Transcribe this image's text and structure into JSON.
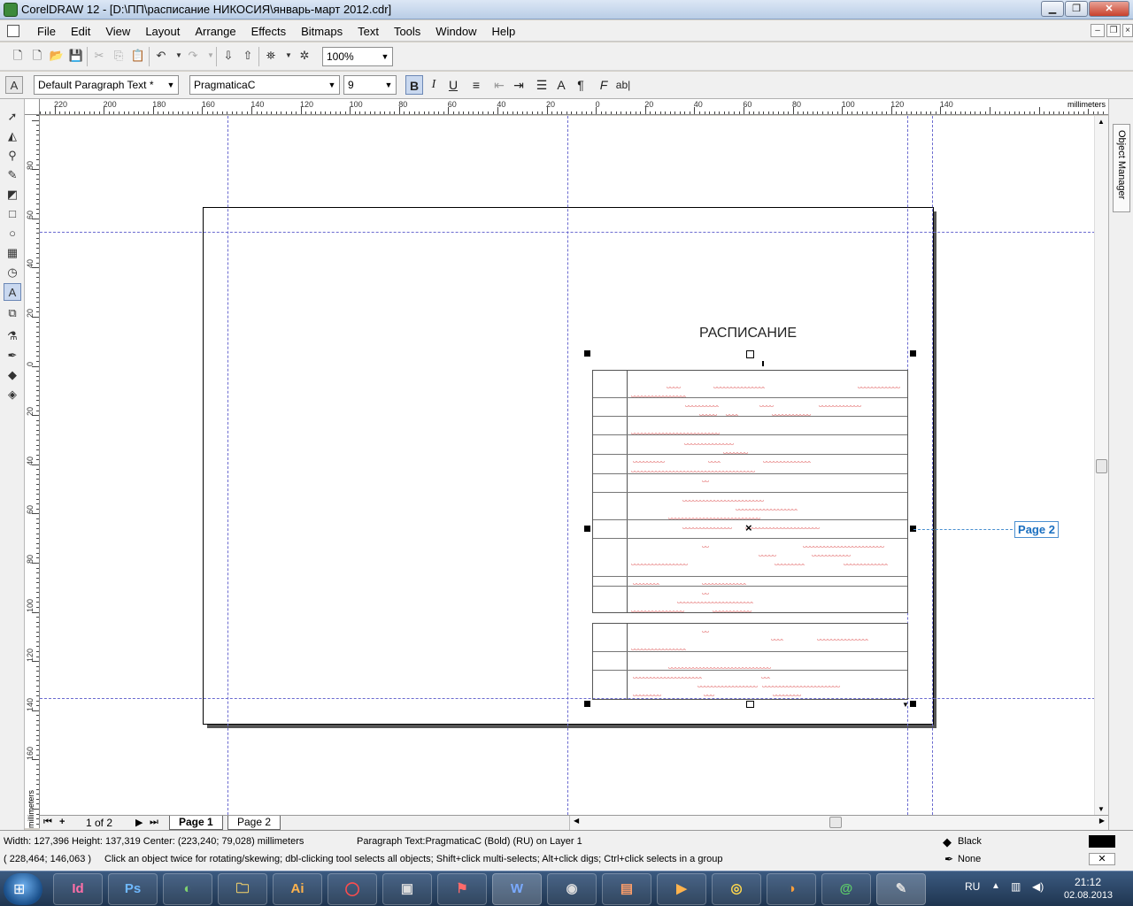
{
  "window": {
    "title": "CorelDRAW 12 - [D:\\ПП\\расписание НИКОСИЯ\\январь-март 2012.cdr]"
  },
  "menu": [
    "File",
    "Edit",
    "View",
    "Layout",
    "Arrange",
    "Effects",
    "Bitmaps",
    "Text",
    "Tools",
    "Window",
    "Help"
  ],
  "toolbar": {
    "zoom": "100%",
    "paragraph_style": "Default Paragraph Text *",
    "font": "PragmaticaC",
    "font_size": "9",
    "format_buttons": {
      "bold": "B",
      "italic": "I",
      "underline": "U",
      "frame": "ab|"
    }
  },
  "ruler": {
    "unit": "millimeters",
    "h_labels": [
      "220",
      "200",
      "180",
      "160",
      "140",
      "120",
      "100",
      "80",
      "60",
      "40",
      "20",
      "0",
      "20",
      "40",
      "60",
      "80",
      "100",
      "120",
      "140"
    ],
    "v_labels": [
      "80",
      "60",
      "40",
      "20",
      "0",
      "20",
      "40",
      "60",
      "80",
      "100",
      "120",
      "140",
      "160"
    ]
  },
  "canvas": {
    "doc_title": "РАСПИСАНИЕ",
    "page_callout": "Page 2"
  },
  "pages": {
    "counter": "1 of 2",
    "tabs": [
      "Page 1",
      "Page 2"
    ]
  },
  "status": {
    "dimensions": "Width: 127,396  Height: 137,319  Center: (223,240; 79,028)  millimeters",
    "object_info": "Paragraph Text:PragmaticaC (Bold) (RU) on Layer 1",
    "cursor": "( 228,464; 146,063 )",
    "hint": "Click an object twice for rotating/skewing; dbl-clicking tool selects all objects; Shift+click multi-selects; Alt+click digs; Ctrl+click selects in a group",
    "fill": "Black",
    "outline": "None"
  },
  "docker": {
    "tab_label": "Object Manager"
  },
  "taskbar": {
    "apps": [
      "Id",
      "Ps",
      "",
      "",
      "Ai",
      "",
      "",
      "",
      "W",
      "",
      "",
      "",
      "",
      "",
      "",
      "",
      ""
    ],
    "language": "RU",
    "time": "21:12",
    "date": "02.08.2013"
  },
  "colors": {
    "fill_swatch": "#000000",
    "guide": "#6b6bd0",
    "spell_error": "#d42020"
  }
}
